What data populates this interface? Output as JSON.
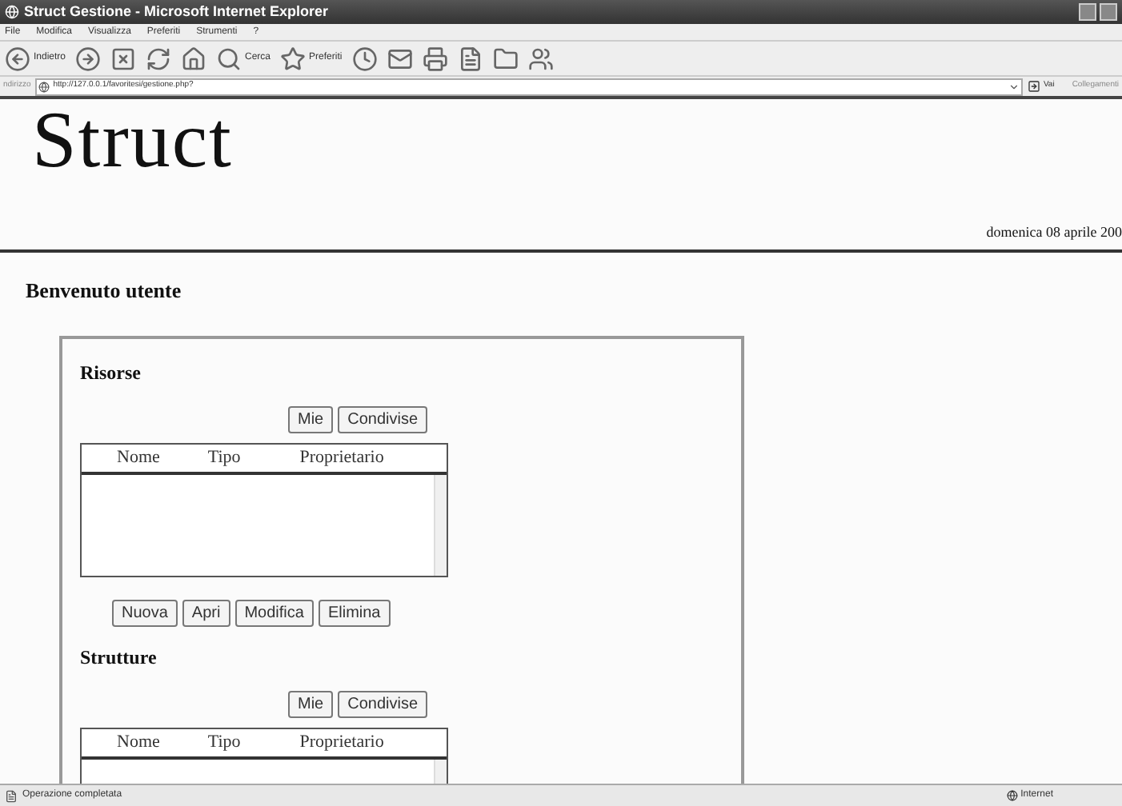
{
  "window": {
    "title": "Struct Gestione - Microsoft Internet Explorer"
  },
  "menu": [
    "File",
    "Modifica",
    "Visualizza",
    "Preferiti",
    "Strumenti",
    "?"
  ],
  "toolbar": {
    "back": "Indietro",
    "search": "Cerca",
    "favorites": "Preferiti"
  },
  "address": {
    "label": "ndirizzo",
    "url": "http://127.0.0.1/favoritesi/gestione.php?",
    "go": "Vai",
    "links": "Collegamenti"
  },
  "page": {
    "logo": "Struct",
    "date": "domenica 08 aprile 200",
    "welcome": "Benvenuto utente",
    "sections": [
      {
        "title": "Risorse",
        "filter_buttons": [
          "Mie",
          "Condivise"
        ],
        "columns": [
          "Nome",
          "Tipo",
          "Proprietario"
        ],
        "action_buttons": [
          "Nuova",
          "Apri",
          "Modifica",
          "Elimina"
        ]
      },
      {
        "title": "Strutture",
        "filter_buttons": [
          "Mie",
          "Condivise"
        ],
        "columns": [
          "Nome",
          "Tipo",
          "Proprietario"
        ]
      }
    ]
  },
  "status_bar": {
    "text": "Operazione completata",
    "zone": "Internet"
  }
}
